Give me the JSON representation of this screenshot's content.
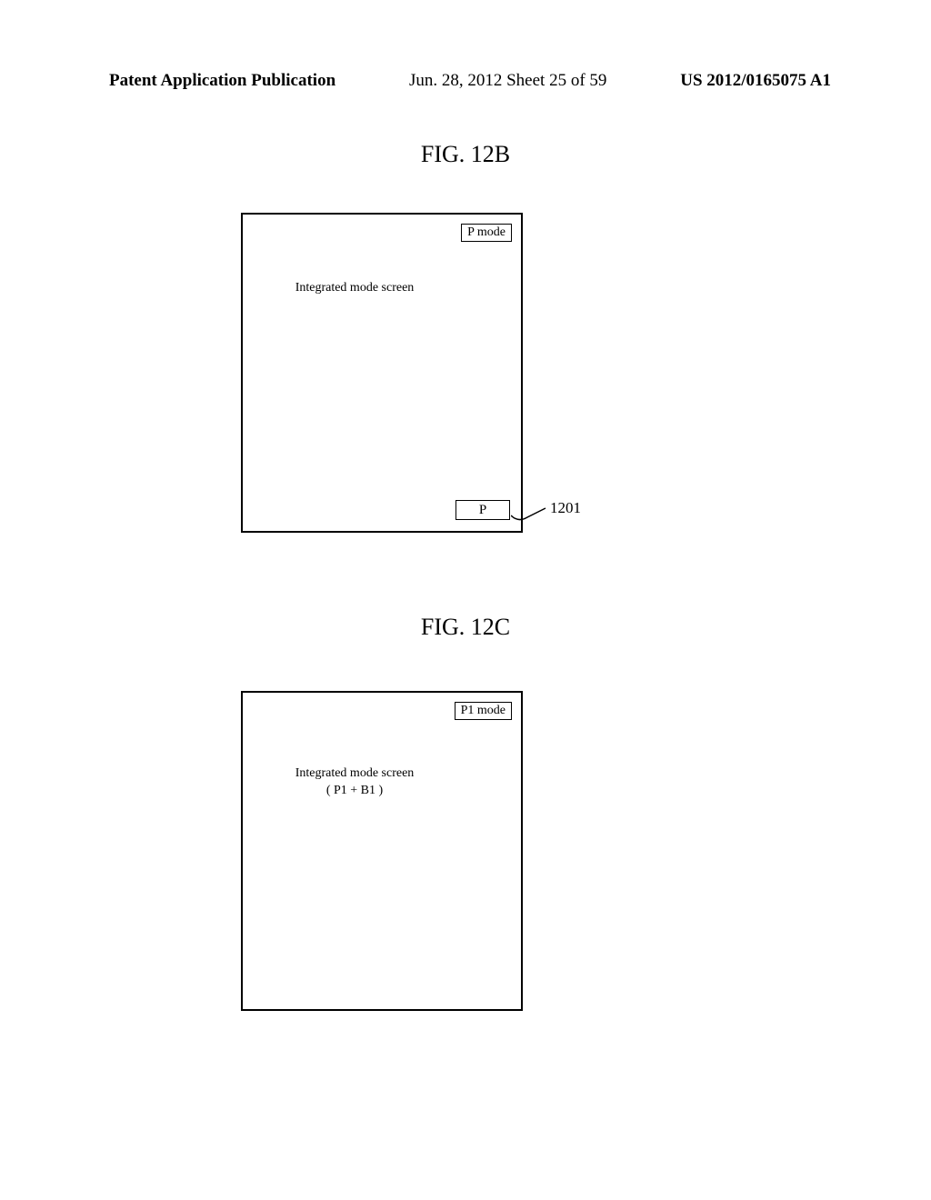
{
  "header": {
    "publication_type": "Patent Application Publication",
    "date_sheet": "Jun. 28, 2012  Sheet 25 of 59",
    "pub_number": "US 2012/0165075 A1"
  },
  "fig_b": {
    "title": "FIG. 12B",
    "mode_label": "P mode",
    "screen_text": "Integrated mode screen",
    "bottom_box": "P",
    "ref": "1201"
  },
  "fig_c": {
    "title": "FIG. 12C",
    "mode_label": "P1 mode",
    "screen_text_line1": "Integrated mode screen",
    "screen_text_line2": "( P1 + B1 )"
  }
}
